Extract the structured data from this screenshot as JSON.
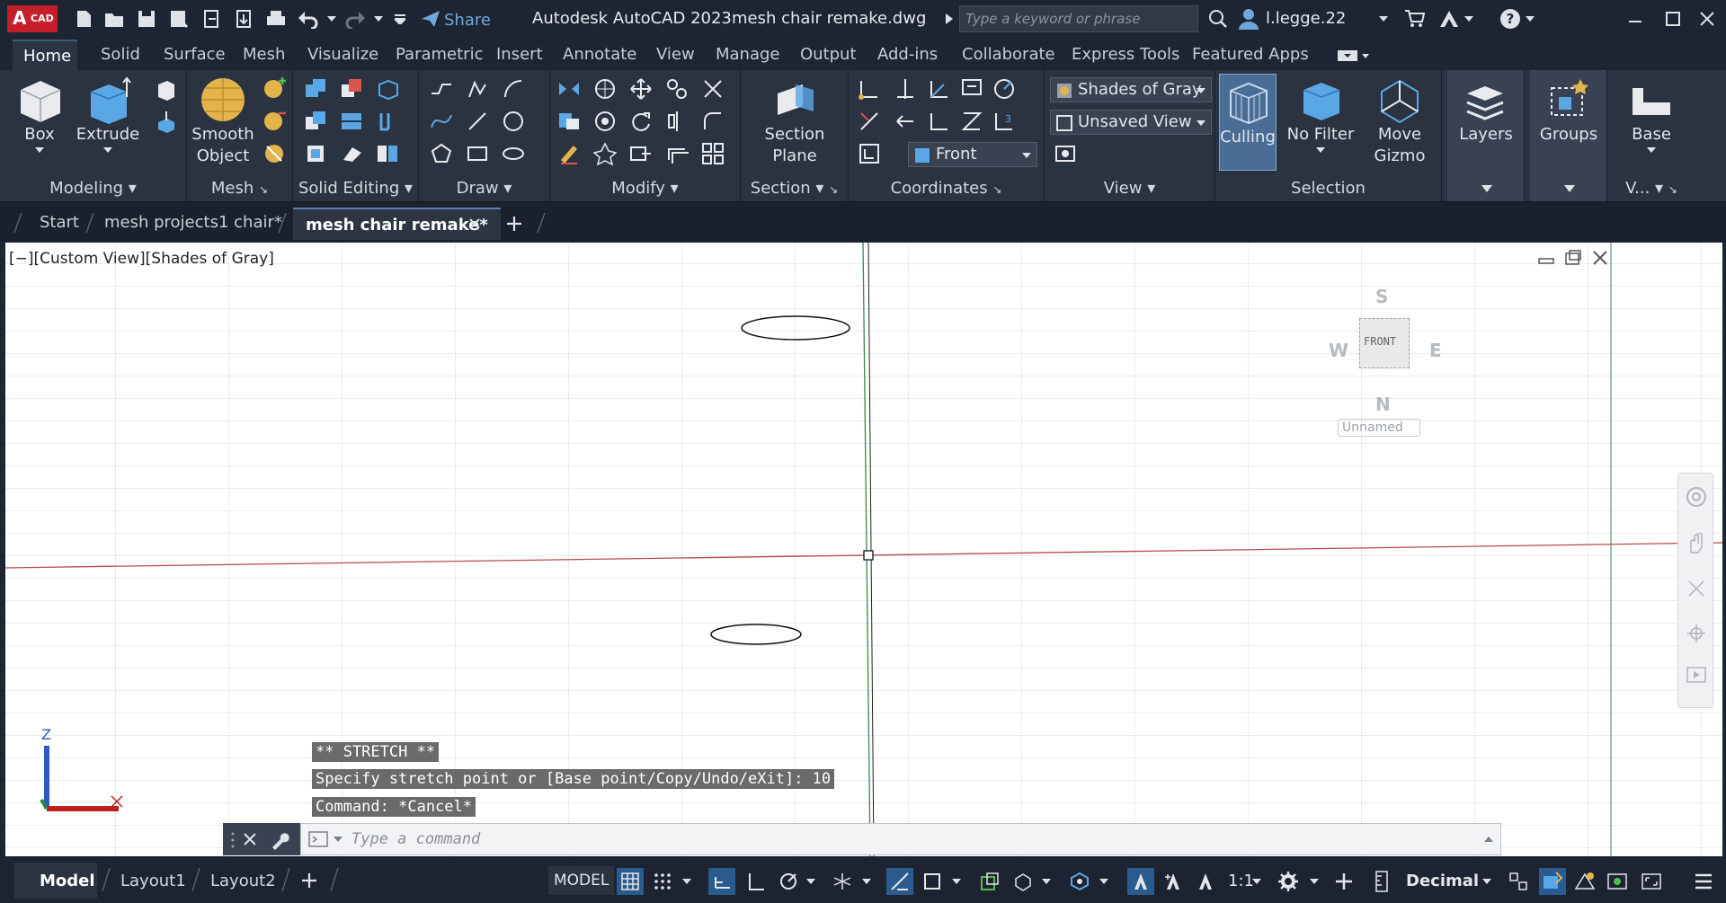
{
  "app": {
    "badge": "A",
    "badge_sub": "CAD",
    "title": "Autodesk AutoCAD 2023",
    "filename": "mesh chair remake.dwg",
    "share_label": "Share",
    "search_placeholder": "Type a keyword or phrase",
    "username": "l.legge.22"
  },
  "ribbon_tabs": [
    "Home",
    "Solid",
    "Surface",
    "Mesh",
    "Visualize",
    "Parametric",
    "Insert",
    "Annotate",
    "View",
    "Manage",
    "Output",
    "Add-ins",
    "Collaborate",
    "Express Tools",
    "Featured Apps"
  ],
  "ribbon": {
    "modeling": {
      "label": "Modeling",
      "box": "Box",
      "extrude": "Extrude"
    },
    "mesh": {
      "label": "Mesh",
      "smooth_object_1": "Smooth",
      "smooth_object_2": "Object"
    },
    "solid_editing": {
      "label": "Solid Editing"
    },
    "draw": {
      "label": "Draw"
    },
    "modify": {
      "label": "Modify"
    },
    "section": {
      "label": "Section",
      "plane_1": "Section",
      "plane_2": "Plane"
    },
    "coordinates": {
      "label": "Coordinates",
      "view_dropdown": "Front"
    },
    "view": {
      "label": "View",
      "visual_style": "Shades of Gray",
      "named_view": "Unsaved View"
    },
    "selection": {
      "label": "Selection",
      "culling": "Culling",
      "no_filter": "No Filter",
      "move_gizmo_1": "Move",
      "move_gizmo_2": "Gizmo"
    },
    "layers": {
      "label": "Layers"
    },
    "groups": {
      "label": "Groups"
    },
    "base": {
      "label": "Base",
      "group_label": "V..."
    }
  },
  "doc_tabs": [
    "Start",
    "mesh projects1 chair*",
    "mesh chair remake*"
  ],
  "viewport": {
    "label": "[−][Custom View][Shades of Gray]",
    "viewcube_face": "FRONT",
    "compass": {
      "s": "S",
      "w": "W",
      "e": "E",
      "n": "N"
    },
    "ucs_name": "Unnamed",
    "ucs_z": "Z"
  },
  "command": {
    "history": [
      "** STRETCH **",
      "Specify stretch point or [Base point/Copy/Undo/eXit]: 10",
      "Command: *Cancel*"
    ],
    "placeholder": "Type a command"
  },
  "status": {
    "layout_tabs": [
      "Model",
      "Layout1",
      "Layout2"
    ],
    "model_label": "MODEL",
    "scale": "1:1",
    "units": "Decimal"
  },
  "colors": {
    "accent": "#2a5b8f",
    "background": "#1d2532",
    "ribbon": "#2b3240",
    "x_axis": "#c02020",
    "y_axis": "#1f8a3a"
  }
}
